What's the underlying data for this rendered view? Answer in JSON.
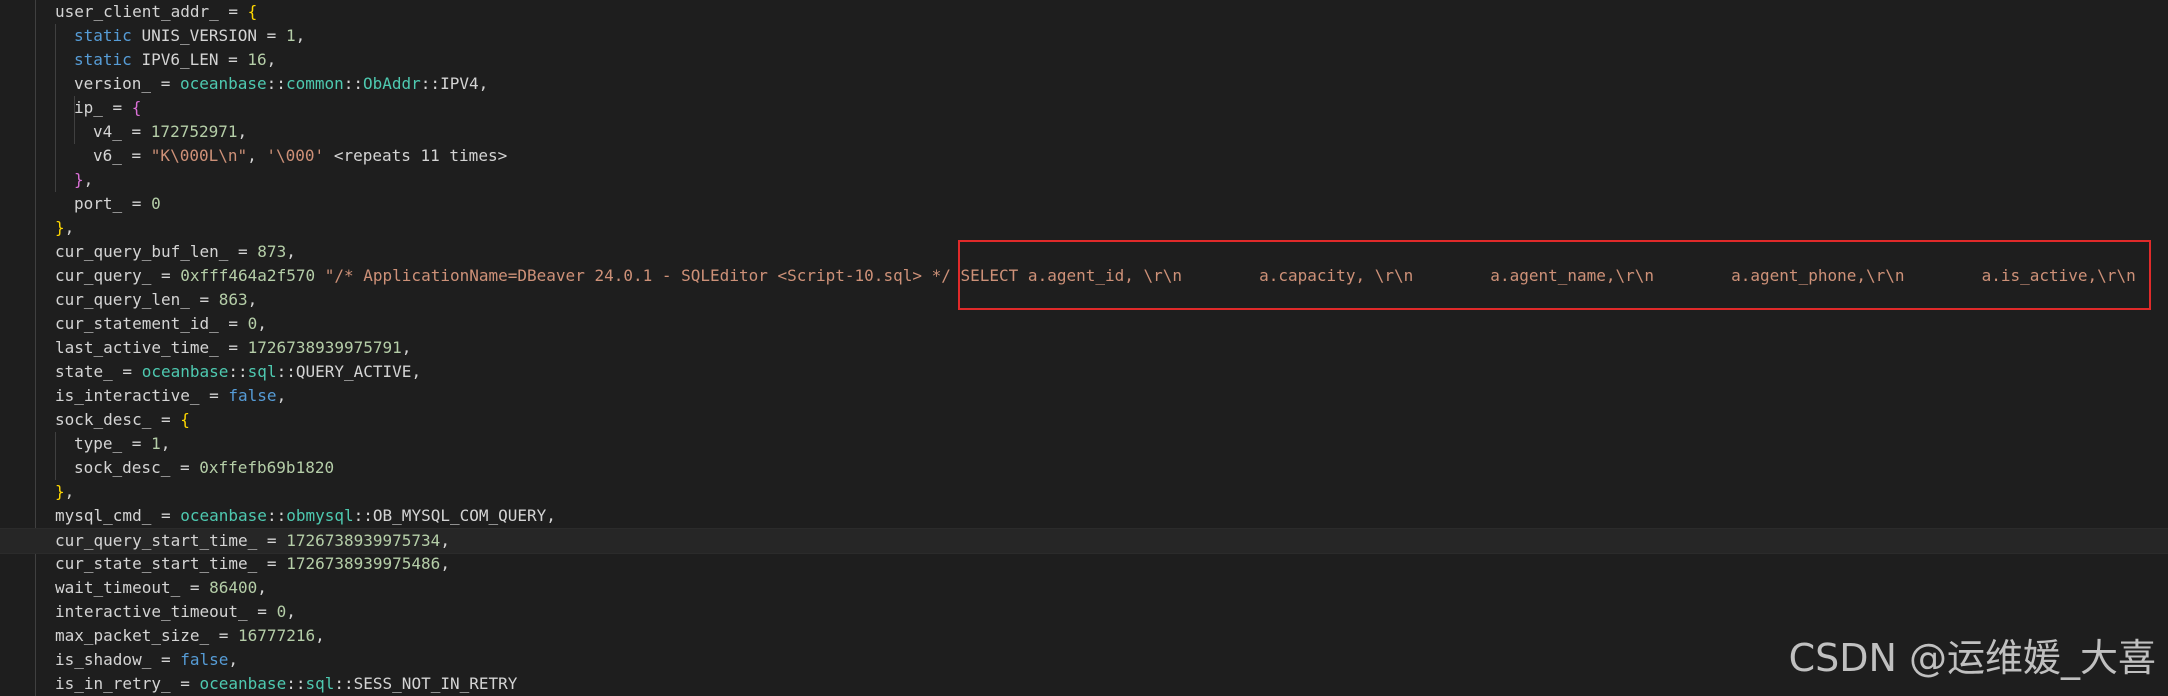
{
  "lines": [
    {
      "indent": 0,
      "tokens": [
        [
          "p",
          "user_client_addr_ = "
        ],
        [
          "b1",
          "{"
        ]
      ]
    },
    {
      "indent": 1,
      "tokens": [
        [
          "k",
          "static "
        ],
        [
          "p",
          "UNIS_VERSION = "
        ],
        [
          "n",
          "1"
        ],
        [
          "p",
          ","
        ]
      ]
    },
    {
      "indent": 1,
      "tokens": [
        [
          "k",
          "static "
        ],
        [
          "p",
          "IPV6_LEN = "
        ],
        [
          "n",
          "16"
        ],
        [
          "p",
          ","
        ]
      ]
    },
    {
      "indent": 1,
      "tokens": [
        [
          "p",
          "version_ = "
        ],
        [
          "ns",
          "oceanbase"
        ],
        [
          "p",
          "::"
        ],
        [
          "ns",
          "common"
        ],
        [
          "p",
          "::"
        ],
        [
          "ns",
          "ObAddr"
        ],
        [
          "p",
          "::IPV4,"
        ]
      ]
    },
    {
      "indent": 1,
      "tokens": [
        [
          "p",
          "ip_ = "
        ],
        [
          "b2",
          "{"
        ]
      ]
    },
    {
      "indent": 2,
      "tokens": [
        [
          "p",
          "v4_ = "
        ],
        [
          "n",
          "172752971"
        ],
        [
          "p",
          ","
        ]
      ]
    },
    {
      "indent": 2,
      "tokens": [
        [
          "p",
          "v6_ = "
        ],
        [
          "s",
          "\"K\\000L\\n\""
        ],
        [
          "p",
          ", "
        ],
        [
          "s",
          "'\\000'"
        ],
        [
          "p",
          " <repeats 11 times>"
        ]
      ]
    },
    {
      "indent": 1,
      "tokens": [
        [
          "b2",
          "}"
        ],
        [
          "p",
          ","
        ]
      ]
    },
    {
      "indent": 1,
      "tokens": [
        [
          "p",
          "port_ = "
        ],
        [
          "n",
          "0"
        ]
      ]
    },
    {
      "indent": 0,
      "tokens": [
        [
          "b1",
          "}"
        ],
        [
          "p",
          ","
        ]
      ]
    },
    {
      "indent": 0,
      "tokens": [
        [
          "p",
          "cur_query_buf_len_ = "
        ],
        [
          "n",
          "873"
        ],
        [
          "p",
          ","
        ]
      ]
    },
    {
      "indent": 0,
      "tokens": [
        [
          "p",
          "cur_query_ = "
        ],
        [
          "n",
          "0xfff464a2f570"
        ],
        [
          "p",
          " "
        ],
        [
          "s",
          "\"/* ApplicationName=DBeaver 24.0.1 - SQLEditor <Script-10.sql> */ SELECT a.agent_id, \\r\\n        a.capacity, \\r\\n        a.agent_name,\\r\\n        a.agent_phone,\\r\\n        a.is_active,\\r\\n"
        ]
      ]
    },
    {
      "indent": 0,
      "tokens": [
        [
          "p",
          "cur_query_len_ = "
        ],
        [
          "n",
          "863"
        ],
        [
          "p",
          ","
        ]
      ]
    },
    {
      "indent": 0,
      "tokens": [
        [
          "p",
          "cur_statement_id_ = "
        ],
        [
          "n",
          "0"
        ],
        [
          "p",
          ","
        ]
      ]
    },
    {
      "indent": 0,
      "tokens": [
        [
          "p",
          "last_active_time_ = "
        ],
        [
          "n",
          "1726738939975791"
        ],
        [
          "p",
          ","
        ]
      ]
    },
    {
      "indent": 0,
      "tokens": [
        [
          "p",
          "state_ = "
        ],
        [
          "ns",
          "oceanbase"
        ],
        [
          "p",
          "::"
        ],
        [
          "ns",
          "sql"
        ],
        [
          "p",
          "::QUERY_ACTIVE,"
        ]
      ]
    },
    {
      "indent": 0,
      "tokens": [
        [
          "p",
          "is_interactive_ = "
        ],
        [
          "k",
          "false"
        ],
        [
          "p",
          ","
        ]
      ]
    },
    {
      "indent": 0,
      "tokens": [
        [
          "p",
          "sock_desc_ = "
        ],
        [
          "b1",
          "{"
        ]
      ]
    },
    {
      "indent": 1,
      "tokens": [
        [
          "p",
          "type_ = "
        ],
        [
          "n",
          "1"
        ],
        [
          "p",
          ","
        ]
      ]
    },
    {
      "indent": 1,
      "tokens": [
        [
          "p",
          "sock_desc_ = "
        ],
        [
          "n",
          "0xffefb69b1820"
        ]
      ]
    },
    {
      "indent": 0,
      "tokens": [
        [
          "b1",
          "}"
        ],
        [
          "p",
          ","
        ]
      ]
    },
    {
      "indent": 0,
      "tokens": [
        [
          "p",
          "mysql_cmd_ = "
        ],
        [
          "ns",
          "oceanbase"
        ],
        [
          "p",
          "::"
        ],
        [
          "ns",
          "obmysql"
        ],
        [
          "p",
          "::OB_MYSQL_COM_QUERY,"
        ]
      ]
    },
    {
      "indent": 0,
      "tokens": [
        [
          "p",
          "cur_query_start_time_ = "
        ],
        [
          "n",
          "1726738939975734"
        ],
        [
          "p",
          ","
        ]
      ]
    },
    {
      "indent": 0,
      "tokens": [
        [
          "p",
          "cur_state_start_time_ = "
        ],
        [
          "n",
          "1726738939975486"
        ],
        [
          "p",
          ","
        ]
      ]
    },
    {
      "indent": 0,
      "tokens": [
        [
          "p",
          "wait_timeout_ = "
        ],
        [
          "n",
          "86400"
        ],
        [
          "p",
          ","
        ]
      ]
    },
    {
      "indent": 0,
      "tokens": [
        [
          "p",
          "interactive_timeout_ = "
        ],
        [
          "n",
          "0"
        ],
        [
          "p",
          ","
        ]
      ]
    },
    {
      "indent": 0,
      "tokens": [
        [
          "p",
          "max_packet_size_ = "
        ],
        [
          "n",
          "16777216"
        ],
        [
          "p",
          ","
        ]
      ]
    },
    {
      "indent": 0,
      "tokens": [
        [
          "p",
          "is_shadow_ = "
        ],
        [
          "k",
          "false"
        ],
        [
          "p",
          ","
        ]
      ]
    },
    {
      "indent": 0,
      "tokens": [
        [
          "p",
          "is_in_retry_ = "
        ],
        [
          "ns",
          "oceanbase"
        ],
        [
          "p",
          "::"
        ],
        [
          "ns",
          "sql"
        ],
        [
          "p",
          "::SESS_NOT_IN_RETRY"
        ]
      ]
    }
  ],
  "highlight_line_index": 22,
  "watermark": "CSDN @运维媛_大喜",
  "colors": {
    "background": "#1e1e1e",
    "keyword": "#569cd6",
    "namespace": "#4ec9b0",
    "string": "#ce9178",
    "number": "#b5cea8",
    "highlight_box": "#e02a2a"
  }
}
